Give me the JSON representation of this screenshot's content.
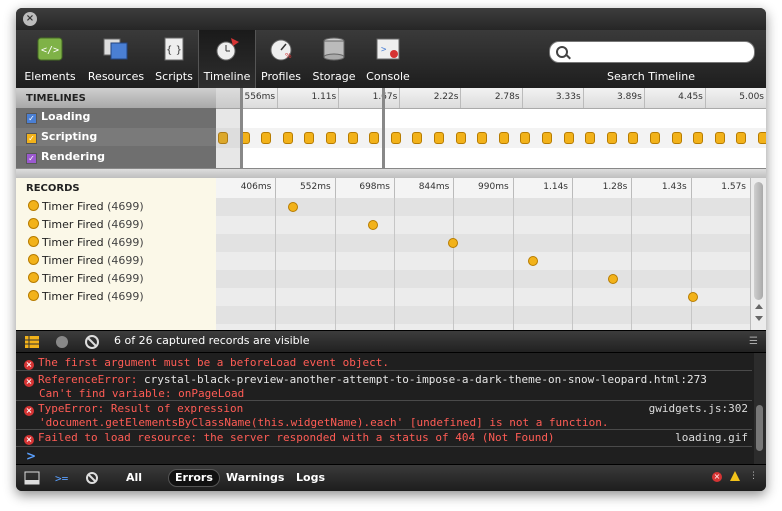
{
  "toolbar": {
    "items": [
      {
        "label": "Elements",
        "icon": "elements-icon"
      },
      {
        "label": "Resources",
        "icon": "resources-icon"
      },
      {
        "label": "Scripts",
        "icon": "scripts-icon"
      },
      {
        "label": "Timeline",
        "icon": "timeline-icon"
      },
      {
        "label": "Profiles",
        "icon": "profiles-icon"
      },
      {
        "label": "Storage",
        "icon": "storage-icon"
      },
      {
        "label": "Console",
        "icon": "console-icon"
      }
    ],
    "active": "Timeline",
    "search_label": "Search Timeline",
    "search_value": ""
  },
  "timelines": {
    "header": "TIMELINES",
    "rows": [
      {
        "label": "Loading",
        "checked": true,
        "color": "#4a7fd4"
      },
      {
        "label": "Scripting",
        "checked": true,
        "color": "#f2b21a"
      },
      {
        "label": "Rendering",
        "checked": true,
        "color": "#9b59d0"
      }
    ],
    "ticks": [
      "556ms",
      "1.11s",
      "1.67s",
      "2.22s",
      "2.78s",
      "3.33s",
      "3.89s",
      "4.45s",
      "5.00s"
    ]
  },
  "records": {
    "header": "RECORDS",
    "ticks": [
      "406ms",
      "552ms",
      "698ms",
      "844ms",
      "990ms",
      "1.14s",
      "1.28s",
      "1.43s",
      "1.57s"
    ],
    "items": [
      {
        "label": "Timer Fired",
        "count": "(4699)"
      },
      {
        "label": "Timer Fired",
        "count": "(4699)"
      },
      {
        "label": "Timer Fired",
        "count": "(4699)"
      },
      {
        "label": "Timer Fired",
        "count": "(4699)"
      },
      {
        "label": "Timer Fired",
        "count": "(4699)"
      },
      {
        "label": "Timer Fired",
        "count": "(4699)"
      }
    ]
  },
  "status": {
    "text": "6 of 26 captured records are visible"
  },
  "console": {
    "messages": [
      {
        "text": "The first argument must be a beforeLoad event object.",
        "source": ""
      },
      {
        "text": "ReferenceError:",
        "detail": "crystal-black-preview-another-attempt-to-impose-a-dark-theme-on-snow-leopard.html:273",
        "text2": "Can't find variable: onPageLoad"
      },
      {
        "text": "TypeError: Result of expression",
        "source": "gwidgets.js:302",
        "text2": "'document.getElementsByClassName(this.widgetName).each' [undefined] is not a function."
      },
      {
        "text": "Failed to load resource: the server responded with a status of 404 (Not Found)",
        "source": "loading.gif"
      }
    ],
    "prompt": ">"
  },
  "bottombar": {
    "filters": [
      "All",
      "Errors",
      "Warnings",
      "Logs"
    ],
    "selected": "Errors"
  }
}
